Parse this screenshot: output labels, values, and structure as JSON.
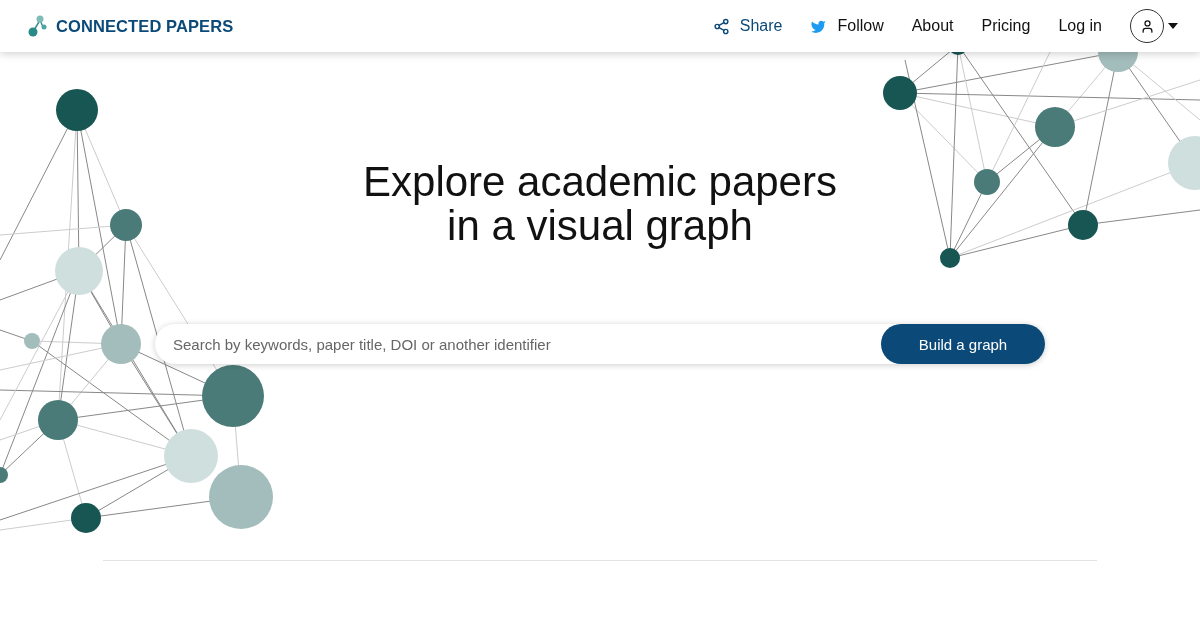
{
  "header": {
    "brand": "CONNECTED PAPERS",
    "nav": [
      {
        "kind": "share",
        "label": "Share"
      },
      {
        "kind": "follow",
        "label": "Follow"
      },
      {
        "kind": "link",
        "label": "About"
      },
      {
        "kind": "link",
        "label": "Pricing"
      },
      {
        "kind": "link",
        "label": "Log in"
      }
    ]
  },
  "hero": {
    "title_lines": [
      "Explore academic papers",
      "in a visual graph"
    ]
  },
  "search": {
    "placeholder": "Search by keywords, paper title, DOI or another identifier",
    "button": "Build a graph"
  }
}
